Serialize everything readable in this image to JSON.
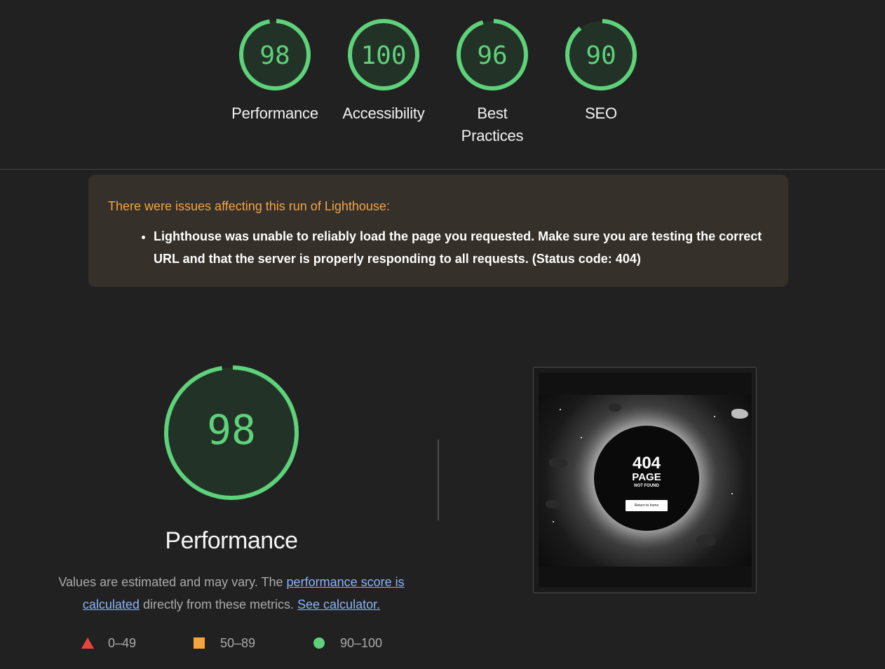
{
  "categories": [
    {
      "score": "98",
      "label": "Performance",
      "fraction": 0.98
    },
    {
      "score": "100",
      "label": "Accessibility",
      "fraction": 1.0
    },
    {
      "score": "96",
      "label": "Best Practices",
      "fraction": 0.96
    },
    {
      "score": "90",
      "label": "SEO",
      "fraction": 0.9
    }
  ],
  "warning": {
    "title": "There were issues affecting this run of Lighthouse:",
    "items": [
      "Lighthouse was unable to reliably load the page you requested. Make sure you are testing the correct URL and that the server is properly responding to all requests. (Status code: 404)"
    ]
  },
  "performance": {
    "score": "98",
    "fraction": 0.98,
    "title": "Performance",
    "desc_prefix": "Values are estimated and may vary. The ",
    "link_score": "performance score is calculated",
    "desc_mid": " directly from these metrics. ",
    "link_calc": "See calculator."
  },
  "legend": [
    {
      "range": "0–49",
      "shape": "triangle",
      "color": "#e8463d"
    },
    {
      "range": "50–89",
      "shape": "square",
      "color": "#f2a540"
    },
    {
      "range": "90–100",
      "shape": "circle",
      "color": "#5dd27a"
    }
  ],
  "screenshot": {
    "code": "404",
    "page": "PAGE",
    "not_found": "NOT FOUND",
    "button": "Return to home"
  },
  "colors": {
    "pass": "#5dd27a",
    "gauge_fill": "#233226",
    "warning_text": "#f1a547",
    "link": "#8ab4f8"
  }
}
